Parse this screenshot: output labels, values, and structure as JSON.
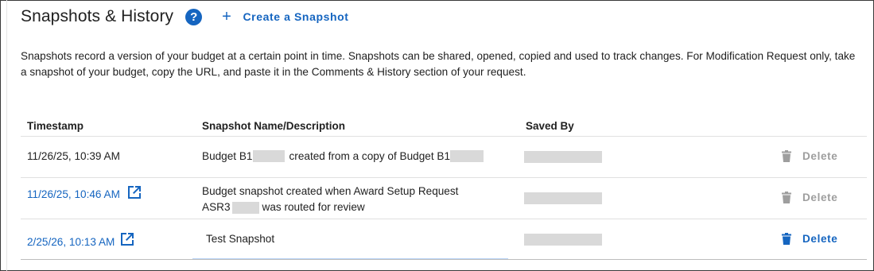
{
  "header": {
    "title": "Snapshots & History",
    "help_icon": "help-circle-icon",
    "help_glyph": "?",
    "create_icon": "plus-icon",
    "create_glyph": "+",
    "create_label": "Create a Snapshot"
  },
  "description": "Snapshots record a version of your budget at a certain point in time. Snapshots can be shared, opened, copied and used to track changes. For Modification Request only, take a snapshot of your budget, copy the URL, and paste it in the Comments & History section of your request.",
  "table": {
    "columns": [
      "Timestamp",
      "Snapshot Name/Description",
      "Saved By"
    ],
    "rows": [
      {
        "timestamp": "11/26/25, 10:39 AM",
        "timestamp_is_link": false,
        "name_parts": [
          "Budget B1",
          "created from a copy of Budget B1"
        ],
        "delete_label": "Delete",
        "delete_enabled": false
      },
      {
        "timestamp": "11/26/25, 10:46 AM",
        "timestamp_is_link": true,
        "name_line1": "Budget snapshot created when Award Setup Request",
        "name_line2_prefix": "ASR3",
        "name_line2_suffix": "was routed for review",
        "delete_label": "Delete",
        "delete_enabled": false
      },
      {
        "timestamp": "2/25/26, 10:13 AM",
        "timestamp_is_link": true,
        "name": "Test Snapshot",
        "delete_label": "Delete",
        "delete_enabled": true
      }
    ]
  },
  "colors": {
    "accent": "#1565c0",
    "disabled": "#9e9e9e",
    "redaction": "#d9d9d9"
  }
}
